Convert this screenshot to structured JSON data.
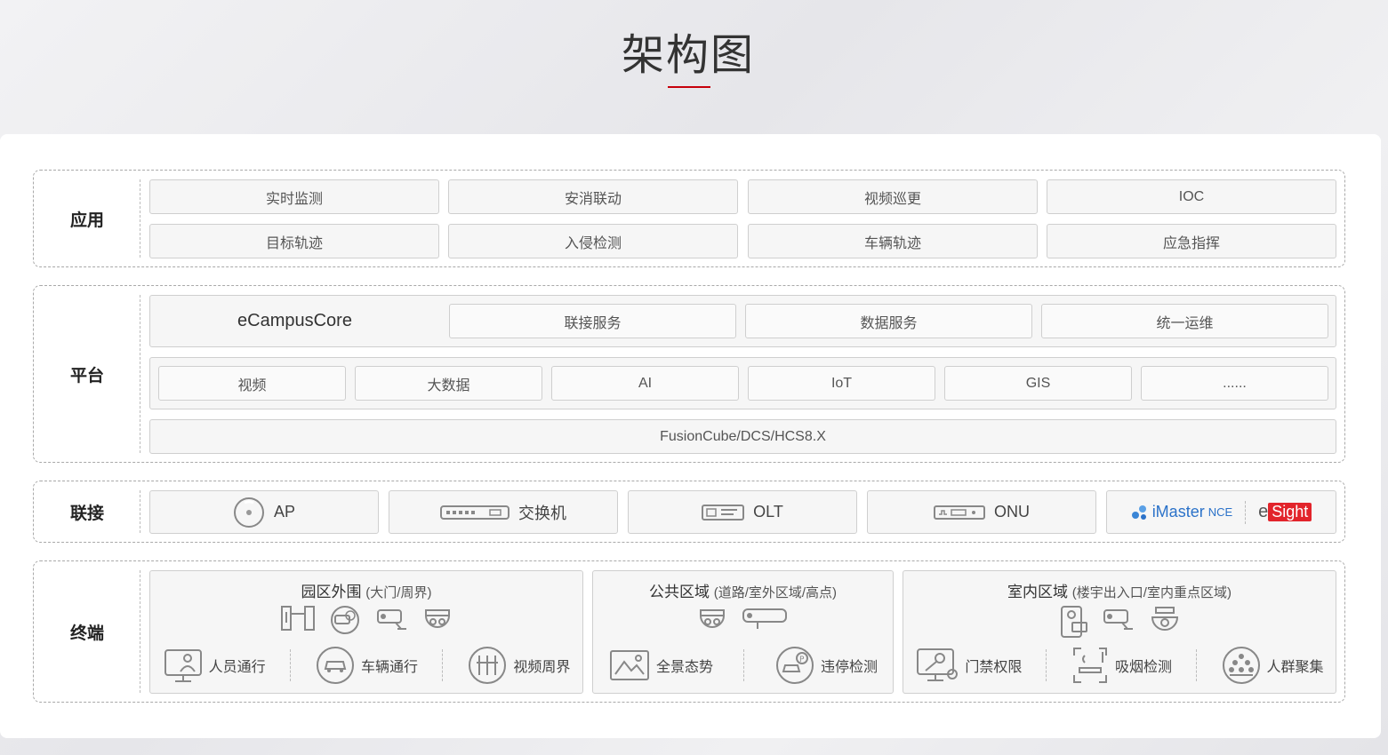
{
  "page": {
    "title": "架构图"
  },
  "layers": {
    "app": {
      "label": "应用",
      "items": [
        "实时监测",
        "安消联动",
        "视频巡更",
        "IOC",
        "目标轨迹",
        "入侵检测",
        "车辆轨迹",
        "应急指挥"
      ]
    },
    "platform": {
      "label": "平台",
      "core": "eCampusCore",
      "services": [
        "联接服务",
        "数据服务",
        "统一运维"
      ],
      "capabilities": [
        "视频",
        "大数据",
        "AI",
        "IoT",
        "GIS",
        "......"
      ],
      "infrastructure": "FusionCube/DCS/HCS8.X"
    },
    "connect": {
      "label": "联接",
      "devices": [
        {
          "name": "AP",
          "icon": "access-point-icon"
        },
        {
          "name": "交换机",
          "icon": "switch-icon"
        },
        {
          "name": "OLT",
          "icon": "olt-icon"
        },
        {
          "name": "ONU",
          "icon": "onu-icon"
        }
      ],
      "management": {
        "imaster": "iMaster",
        "nce": "NCE",
        "esight_e": "e",
        "esight_sight": "Sight"
      }
    },
    "terminal": {
      "label": "终端",
      "zones": [
        {
          "title": "园区外围",
          "subtitle": "(大门/周界)",
          "device_icons": [
            "gate-barrier-icon",
            "parking-camera-icon",
            "bullet-camera-icon",
            "dome-camera-icon"
          ],
          "scenes": [
            {
              "label": "人员通行",
              "icon": "person-access-icon"
            },
            {
              "label": "车辆通行",
              "icon": "vehicle-access-icon"
            },
            {
              "label": "视频周界",
              "icon": "video-perimeter-icon"
            }
          ]
        },
        {
          "title": "公共区域",
          "subtitle": "(道路/室外区域/高点)",
          "device_icons": [
            "dome-camera-icon",
            "ptz-bullet-camera-icon"
          ],
          "scenes": [
            {
              "label": "全景态势",
              "icon": "panorama-icon"
            },
            {
              "label": "违停检测",
              "icon": "illegal-parking-icon"
            }
          ]
        },
        {
          "title": "室内区域",
          "subtitle": "(楼宇出入口/室内重点区域)",
          "device_icons": [
            "access-terminal-icon",
            "bullet-camera-icon",
            "dome-camera-icon"
          ],
          "scenes": [
            {
              "label": "门禁权限",
              "icon": "access-control-icon"
            },
            {
              "label": "吸烟检测",
              "icon": "smoking-detection-icon"
            },
            {
              "label": "人群聚集",
              "icon": "crowd-gathering-icon"
            }
          ]
        }
      ]
    }
  },
  "colors": {
    "accent": "#c7000b",
    "imaster": "#2b72c9",
    "esight": "#e2242b"
  }
}
